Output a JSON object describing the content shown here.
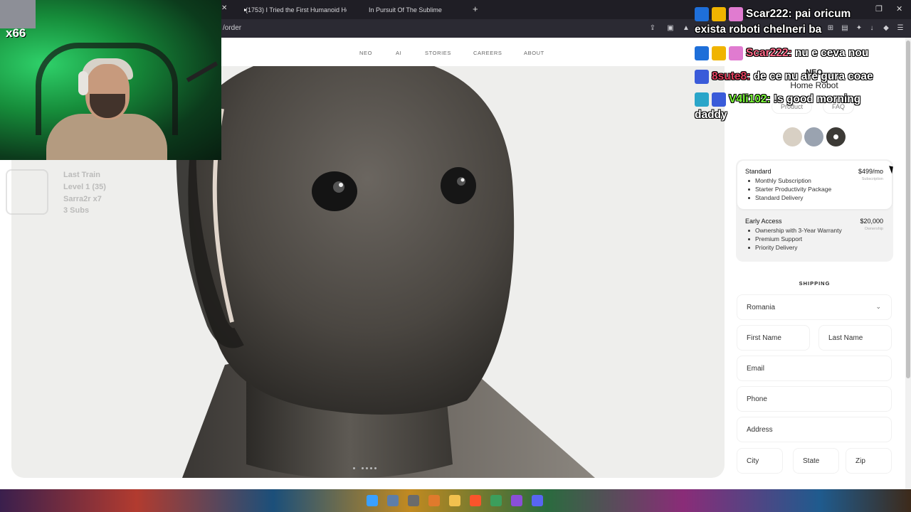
{
  "browser": {
    "tabs": [
      {
        "label": "(1753) I Tried the First Humanoid Ho",
        "icon": "youtube-icon"
      },
      {
        "label": "In Pursuit Of The Sublime",
        "icon": "page-icon"
      }
    ],
    "url": "/order"
  },
  "site_nav": {
    "items": [
      "NEO",
      "AI",
      "STORIES",
      "CAREERS",
      "ABOUT"
    ]
  },
  "product": {
    "title": "NEO",
    "subtitle": "Home Robot",
    "tabs": [
      "Product",
      "FAQ"
    ],
    "colors": [
      "#d8d0c4",
      "#9aa3b0",
      "#3c3a36"
    ],
    "selected_color_index": 2
  },
  "plans": [
    {
      "name": "Standard",
      "price": "$499/mo",
      "note": "Subscription",
      "features": [
        "Monthly Subscription",
        "Starter Productivity Package",
        "Standard Delivery"
      ]
    },
    {
      "name": "Early Access",
      "price": "$20,000",
      "note": "Ownership",
      "features": [
        "Ownership with 3-Year Warranty",
        "Premium Support",
        "Priority Delivery"
      ]
    }
  ],
  "shipping": {
    "heading": "SHIPPING",
    "country": "Romania",
    "first_name": "First Name",
    "last_name": "Last Name",
    "email": "Email",
    "phone": "Phone",
    "address": "Address",
    "city": "City",
    "state": "State",
    "zip": "Zip"
  },
  "carousel": {
    "count": 6,
    "active_index": 1
  },
  "stream": {
    "cam_counter": "x66",
    "widget": [
      "Last Train",
      "Level 1 (35)",
      "Sarra2r x7",
      "3 Subs"
    ],
    "chat": [
      {
        "user": "Scar222:",
        "user_color": "#ffffff",
        "message": "pai oricum",
        "message2": "exista roboti chelneri ba"
      },
      {
        "user": "Scar222:",
        "user_color": "#ff6b8a",
        "message": "nu e ceva nou"
      },
      {
        "user": "8sute8:",
        "user_color": "#e0405e",
        "message": "de ce nu are gura coae"
      },
      {
        "user": "V4li102:",
        "user_color": "#7cfc3a",
        "message": "!s good morning",
        "message2": "daddy"
      }
    ]
  }
}
